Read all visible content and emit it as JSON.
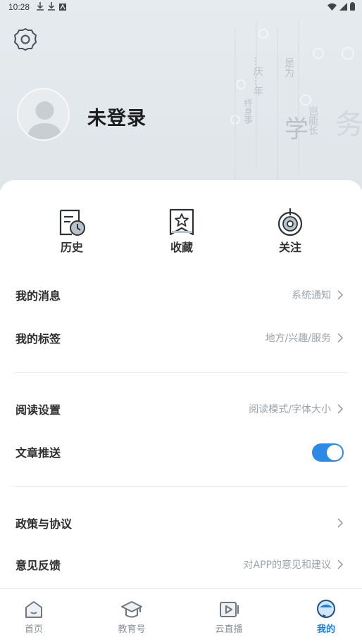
{
  "status_bar": {
    "time": "10:28"
  },
  "profile": {
    "title": "未登录"
  },
  "header_decor": {
    "lines": [
      "一兴学是为",
      "学",
      "…庆…年",
      "…岂能长",
      "…学者身事"
    ]
  },
  "quick_actions": [
    {
      "label": "历史",
      "icon": "history-icon"
    },
    {
      "label": "收藏",
      "icon": "bookmark-star-icon"
    },
    {
      "label": "关注",
      "icon": "follow-target-icon"
    }
  ],
  "menu": {
    "messages": {
      "label": "我的消息",
      "value": "系统通知"
    },
    "tags": {
      "label": "我的标签",
      "value": "地方/兴趣/服务"
    },
    "reading": {
      "label": "阅读设置",
      "value": "阅读模式/字体大小"
    },
    "push": {
      "label": "文章推送",
      "enabled": true
    },
    "policy": {
      "label": "政策与协议",
      "value": ""
    },
    "feedback": {
      "label": "意见反馈",
      "value": "对APP的意见和建议"
    }
  },
  "bottom_nav": [
    {
      "label": "首页",
      "icon": "home-icon",
      "active": false
    },
    {
      "label": "教育号",
      "icon": "graduation-cap-icon",
      "active": false
    },
    {
      "label": "云直播",
      "icon": "video-play-icon",
      "active": false
    },
    {
      "label": "我的",
      "icon": "profile-bubble-icon",
      "active": true
    }
  ],
  "colors": {
    "accent": "#1e7fe0",
    "toggle": "#2b8ae8",
    "header_bg": "#e2e8eb"
  }
}
